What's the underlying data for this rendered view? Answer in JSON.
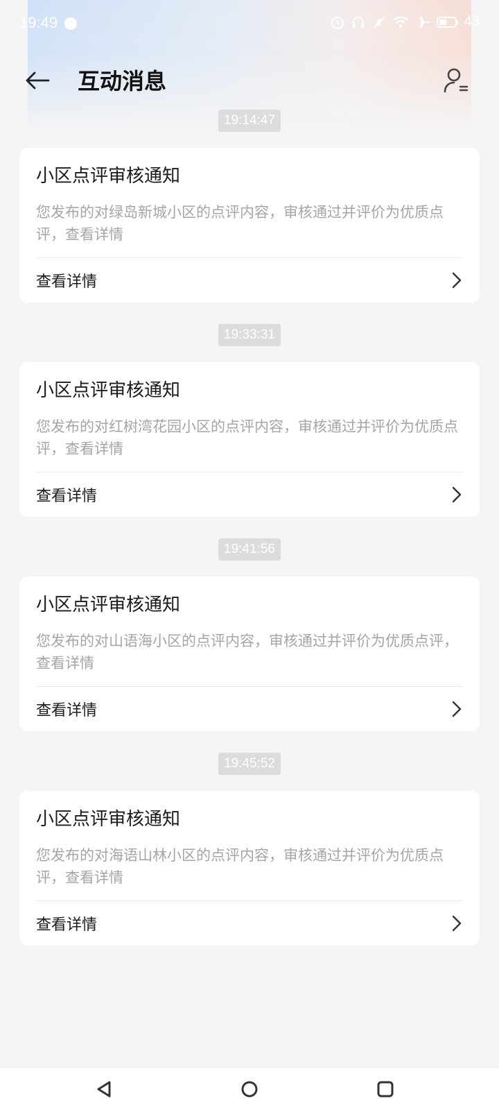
{
  "status_bar": {
    "time": "19:49",
    "battery": "43",
    "icons": [
      "alarm-icon",
      "headphones-icon",
      "mute-icon",
      "wifi-icon",
      "airplane-icon",
      "battery-icon"
    ]
  },
  "header": {
    "title": "互动消息",
    "back_icon": "arrow-left-icon",
    "profile_icon": "user-list-icon"
  },
  "messages": [
    {
      "time": "19:14:47",
      "title": "小区点评审核通知",
      "body": "您发布的对绿岛新城小区的点评内容，审核通过并评价为优质点评，查看详情",
      "link_label": "查看详情"
    },
    {
      "time": "19:33:31",
      "title": "小区点评审核通知",
      "body": "您发布的对红树湾花园小区的点评内容，审核通过并评价为优质点评，查看详情",
      "link_label": "查看详情"
    },
    {
      "time": "19:41:56",
      "title": "小区点评审核通知",
      "body": "您发布的对山语海小区的点评内容，审核通过并评价为优质点评，查看详情",
      "link_label": "查看详情"
    },
    {
      "time": "19:45:52",
      "title": "小区点评审核通知",
      "body": "您发布的对海语山林小区的点评内容，审核通过并评价为优质点评，查看详情",
      "link_label": "查看详情"
    }
  ],
  "nav_bar": {
    "icons": [
      "back-triangle-icon",
      "home-circle-icon",
      "recents-square-icon"
    ]
  },
  "colors": {
    "background": "#f5f5f5",
    "card": "#ffffff",
    "body_text": "#a5a5a5",
    "timestamp_bg": "#dcdcdc"
  }
}
